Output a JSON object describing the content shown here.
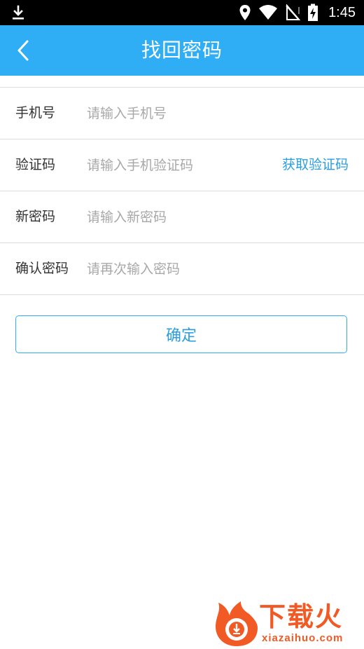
{
  "status_bar": {
    "time": "1:45",
    "icons": [
      "download-icon",
      "location-icon",
      "wifi-icon",
      "no-sim-icon",
      "battery-charging-icon"
    ]
  },
  "header": {
    "title": "找回密码",
    "back_icon": "chevron-left-icon"
  },
  "form": {
    "phone": {
      "label": "手机号",
      "placeholder": "请输入手机号"
    },
    "code": {
      "label": "验证码",
      "placeholder": "请输入手机验证码",
      "action_label": "获取验证码"
    },
    "new_password": {
      "label": "新密码",
      "placeholder": "请输入新密码"
    },
    "confirm_password": {
      "label": "确认密码",
      "placeholder": "请再次输入密码"
    }
  },
  "confirm_button": {
    "label": "确定"
  },
  "watermark": {
    "title": "下载火",
    "url": "xiazaihuo.com"
  },
  "colors": {
    "primary": "#30aef5",
    "link": "#2a9ee0",
    "watermark": "#f15a24"
  }
}
